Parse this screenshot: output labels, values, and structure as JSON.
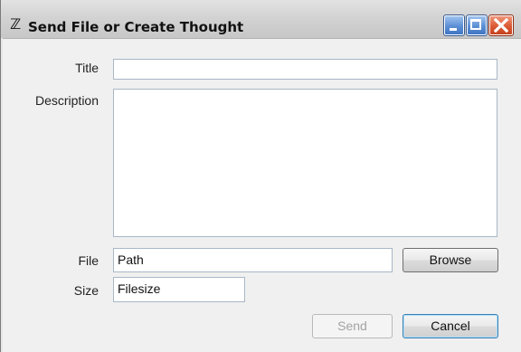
{
  "window": {
    "app_icon": "ℤ",
    "title": "Send File or Create Thought"
  },
  "form": {
    "title_label": "Title",
    "title_value": "",
    "description_label": "Description",
    "description_value": "",
    "file_label": "File",
    "file_value": "Path",
    "browse_label": "Browse",
    "size_label": "Size",
    "size_value": "Filesize"
  },
  "actions": {
    "send_label": "Send",
    "cancel_label": "Cancel"
  },
  "icons": {
    "minimize": "minimize-icon",
    "maximize": "maximize-icon",
    "close": "close-icon"
  }
}
